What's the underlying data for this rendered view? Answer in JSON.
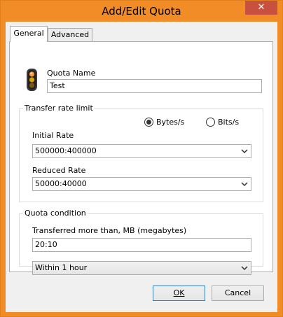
{
  "window": {
    "title": "Add/Edit Quota",
    "close_glyph": "✕"
  },
  "tabs": [
    {
      "label": "General",
      "active": true
    },
    {
      "label": "Advanced",
      "active": false
    }
  ],
  "quota_name": {
    "label": "Quota Name",
    "value": "Test",
    "icon": "traffic-light-icon"
  },
  "transfer_rate": {
    "group_label": "Transfer rate limit",
    "unit_options": [
      {
        "label": "Bytes/s",
        "selected": true
      },
      {
        "label": "Bits/s",
        "selected": false
      }
    ],
    "initial_rate": {
      "label": "Initial Rate",
      "value": "500000:400000"
    },
    "reduced_rate": {
      "label": "Reduced Rate",
      "value": "50000:40000"
    }
  },
  "quota_condition": {
    "group_label": "Quota condition",
    "transferred_label": "Transferred more than, MB (megabytes)",
    "transferred_value": "20:10",
    "period_selected": "Within 1 hour"
  },
  "buttons": {
    "ok": "OK",
    "cancel": "Cancel"
  },
  "colors": {
    "title_bar": "#f28c27",
    "close_button": "#c7503f",
    "default_button_border": "#3c7fb1"
  }
}
